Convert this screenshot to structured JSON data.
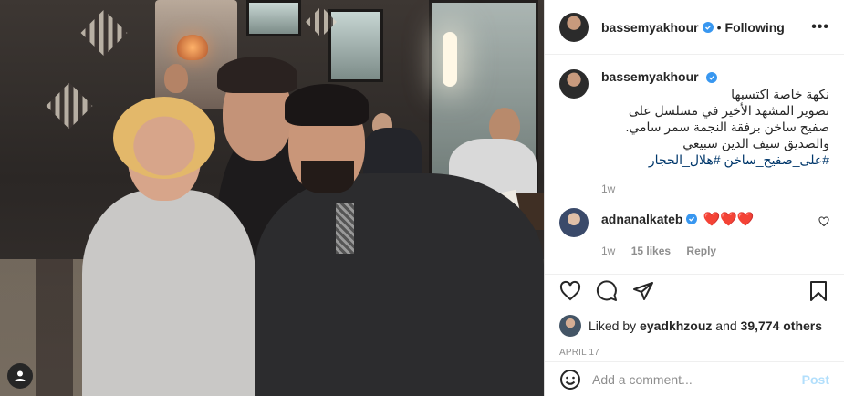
{
  "post": {
    "username": "bassemyakhour",
    "separator": "•",
    "follow_status": "Following",
    "more_label": "•••",
    "caption_lines": [
      "نكهة خاصة اكتسبها",
      "تصوير المشهد الأخير في مسلسل على",
      "صفيح ساخن برفقة النجمة سمر سامي.",
      "والصديق سيف الدين سبيعي"
    ],
    "caption_tags": "#على_صفيح_ساخن #هلال_الحجار",
    "caption_time": "1w"
  },
  "comment": {
    "username": "adnanalkateb",
    "text": "❤️❤️❤️",
    "time": "1w",
    "likes": "15 likes",
    "reply": "Reply"
  },
  "likes": {
    "prefix": "Liked by",
    "user": "eyadkhzouz",
    "middle": "and",
    "count": "39,774 others"
  },
  "date": "APRIL 17",
  "add_comment": {
    "placeholder": "Add a comment...",
    "post_label": "Post"
  },
  "colors": {
    "verified": "#3897f0",
    "post_disabled": "#b2dffc",
    "heart": "#e0245e"
  }
}
